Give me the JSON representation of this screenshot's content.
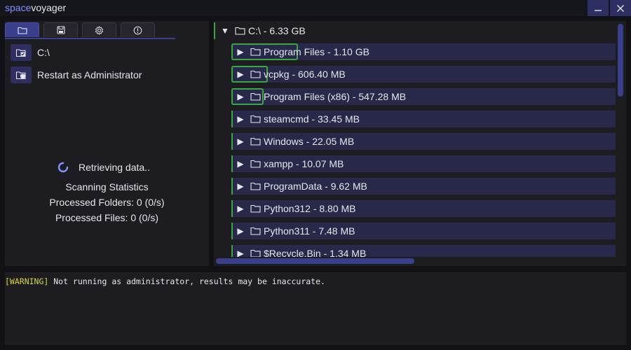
{
  "window": {
    "title_accent": "space",
    "title_rest": "voyager",
    "minimize_icon": "minimize-icon",
    "close_icon": "close-icon"
  },
  "colors": {
    "accent": "#3a3f8c",
    "progress": "#3aa542",
    "warning": "#d7d43a",
    "row_bg": "#28294a"
  },
  "tabs": [
    {
      "icon": "folder-icon",
      "active": true
    },
    {
      "icon": "save-icon",
      "active": false
    },
    {
      "icon": "gear-icon",
      "active": false
    },
    {
      "icon": "info-icon",
      "active": false
    }
  ],
  "actions": {
    "drive_label": "C:\\",
    "admin_label": "Restart as Administrator"
  },
  "status": {
    "retrieving": "Retrieving data..",
    "heading": "Scanning Statistics",
    "folders": "Processed Folders: 0 (0/s)",
    "files": "Processed Files: 0 (0/s)"
  },
  "tree": {
    "root": "C:\\ - 6.33 GB",
    "items": [
      {
        "label": "Program Files - 1.10 GB",
        "fraction": 0.174
      },
      {
        "label": "vcpkg - 606.40 MB",
        "fraction": 0.094
      },
      {
        "label": "Program Files (x86) - 547.28 MB",
        "fraction": 0.084
      },
      {
        "label": "steamcmd - 33.45 MB",
        "fraction": 0.005
      },
      {
        "label": "Windows - 22.05 MB",
        "fraction": 0.003
      },
      {
        "label": "xampp - 10.07 MB",
        "fraction": 0.002
      },
      {
        "label": "ProgramData - 9.62 MB",
        "fraction": 0.001
      },
      {
        "label": "Python312 - 8.80 MB",
        "fraction": 0.001
      },
      {
        "label": "Python311 - 7.48 MB",
        "fraction": 0.001
      },
      {
        "label": "$Recycle.Bin - 1.34 MB",
        "fraction": 0.0
      }
    ]
  },
  "log": {
    "tag": "[WARNING]",
    "message": " Not running as administrator, results may be inaccurate."
  }
}
